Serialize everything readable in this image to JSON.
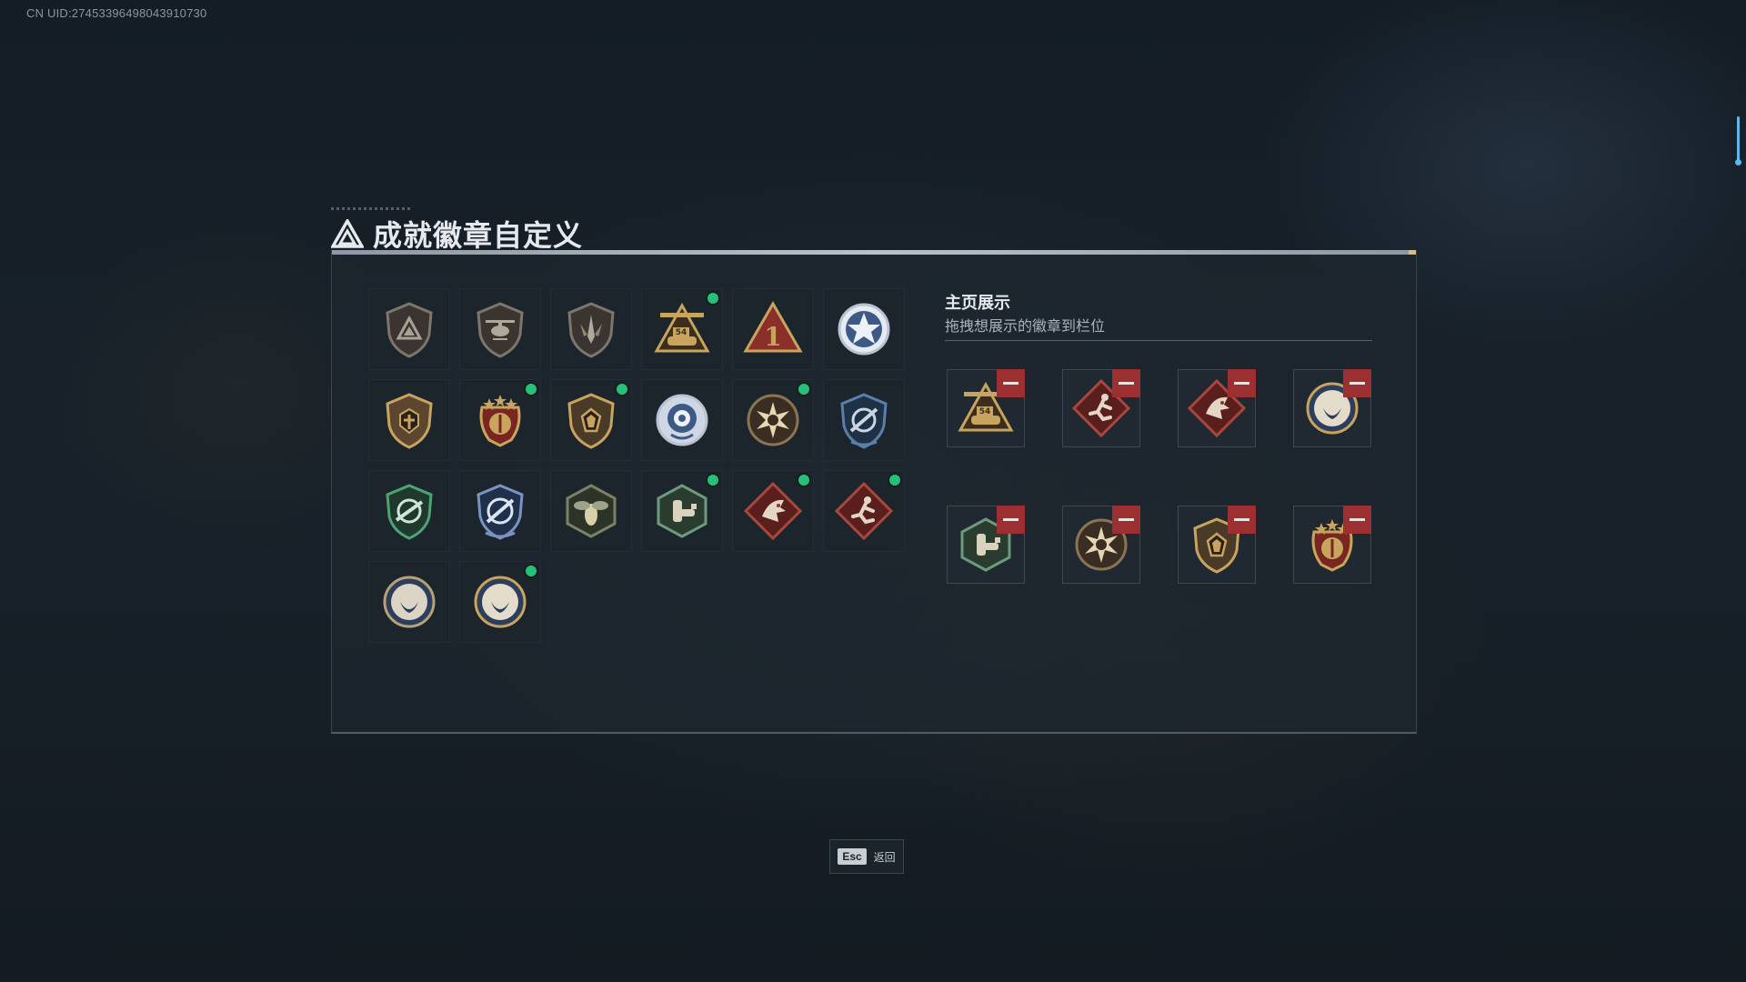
{
  "uid_text": "CN UID:274533964980439107​30",
  "page": {
    "title": "成就徽章自定义",
    "accent_color": "#27c07a",
    "remove_color": "#9b2f31"
  },
  "badge_grid": [
    {
      "icon": "triangle-shield-badge",
      "new": false
    },
    {
      "icon": "helicopter-shield-badge",
      "new": false
    },
    {
      "icon": "blade-shield-badge",
      "new": false
    },
    {
      "icon": "tank-54-badge",
      "new": true
    },
    {
      "icon": "rank-1-badge",
      "new": false
    },
    {
      "icon": "star-emblem-badge",
      "new": false
    },
    {
      "icon": "bronze-shield-badge",
      "new": false
    },
    {
      "icon": "laurel-shield-badge",
      "new": true
    },
    {
      "icon": "gem-shield-badge",
      "new": true
    },
    {
      "icon": "rose-emblem-badge",
      "new": false
    },
    {
      "icon": "sunburst-badge",
      "new": true
    },
    {
      "icon": "crosshair-shield-badge",
      "new": false
    },
    {
      "icon": "green-rifle-badge",
      "new": false
    },
    {
      "icon": "blue-crosshair-badge",
      "new": false
    },
    {
      "icon": "wasp-badge",
      "new": false
    },
    {
      "icon": "mech-arm-badge",
      "new": true
    },
    {
      "icon": "dragon-badge",
      "new": true
    },
    {
      "icon": "runner-badge",
      "new": true
    },
    {
      "icon": "wolf-emblem-badge",
      "new": false
    },
    {
      "icon": "wolf-emblem-gold-badge",
      "new": true
    }
  ],
  "showcase": {
    "title": "主页展示",
    "subtitle": "拖拽想展示的徽章到栏位",
    "slots": [
      {
        "icon": "tank-54-badge"
      },
      {
        "icon": "runner-badge"
      },
      {
        "icon": "dragon-badge"
      },
      {
        "icon": "wolf-emblem-gold-badge"
      },
      {
        "icon": "mech-arm-badge"
      },
      {
        "icon": "sunburst-badge"
      },
      {
        "icon": "gem-shield-badge"
      },
      {
        "icon": "laurel-shield-badge"
      }
    ]
  },
  "footer": {
    "esc_key": "Esc",
    "esc_label": "返回"
  }
}
